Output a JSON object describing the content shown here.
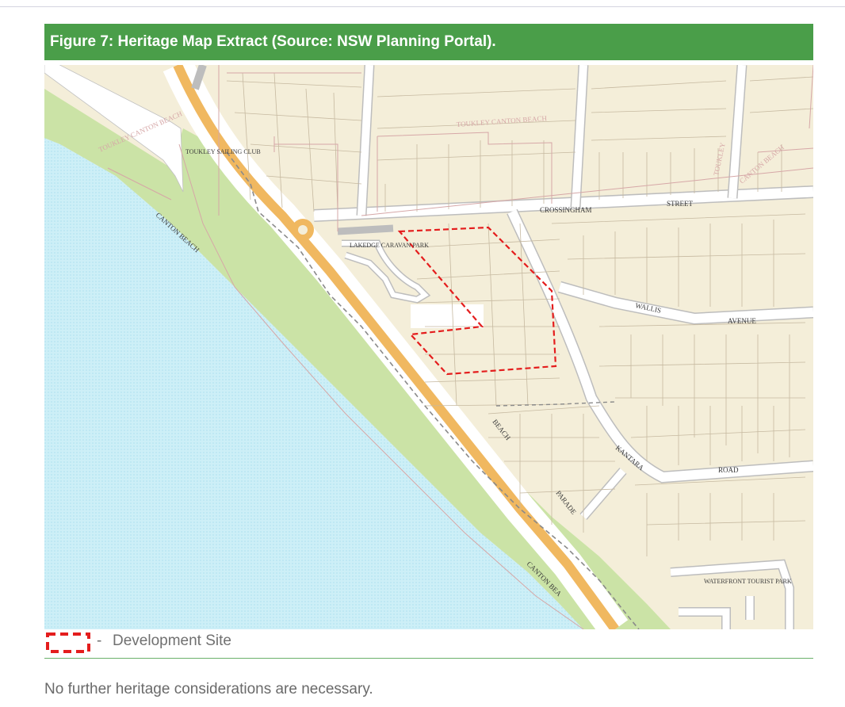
{
  "figure": {
    "title": "Figure 7: Heritage Map Extract (Source: NSW Planning Portal)."
  },
  "map": {
    "colors": {
      "water": "#cdeff7",
      "reserve": "#cbe3a6",
      "land": "#f4eed9",
      "road": "#ffffff",
      "main_road": "#f0b860",
      "site_outline": "#e41d1d",
      "heritage": "#d6a7a7"
    },
    "labels": {
      "toukley_sailing_club": "TOUKLEY SAILING CLUB",
      "toukley_canton_beach_1": "TOUKLEY CANTON BEACH",
      "toukley_canton_beach_2": "TOUKLEY CANTON BEACH",
      "toukley_3": "TOUKLEY",
      "canton_beach_3": "CANTON BEACH",
      "lakedge_caravan_park": "LAKEDGE CARAVAN PARK",
      "crossingham": "CROSSINGHAM",
      "street": "STREET",
      "wallis": "WALLIS",
      "avenue": "AVENUE",
      "kantara": "KANTARA",
      "road": "ROAD",
      "beach": "BEACH",
      "parade": "PARADE",
      "canton_beach_shore": "CANTON BEACH",
      "canton_beach_shore2": "CANTON BEA",
      "waterfront_tourist_park": "WATERFRONT TOURIST PARK"
    }
  },
  "legend": {
    "dash": "-",
    "label": "Development Site"
  },
  "body": {
    "text": "No further heritage considerations are necessary."
  }
}
